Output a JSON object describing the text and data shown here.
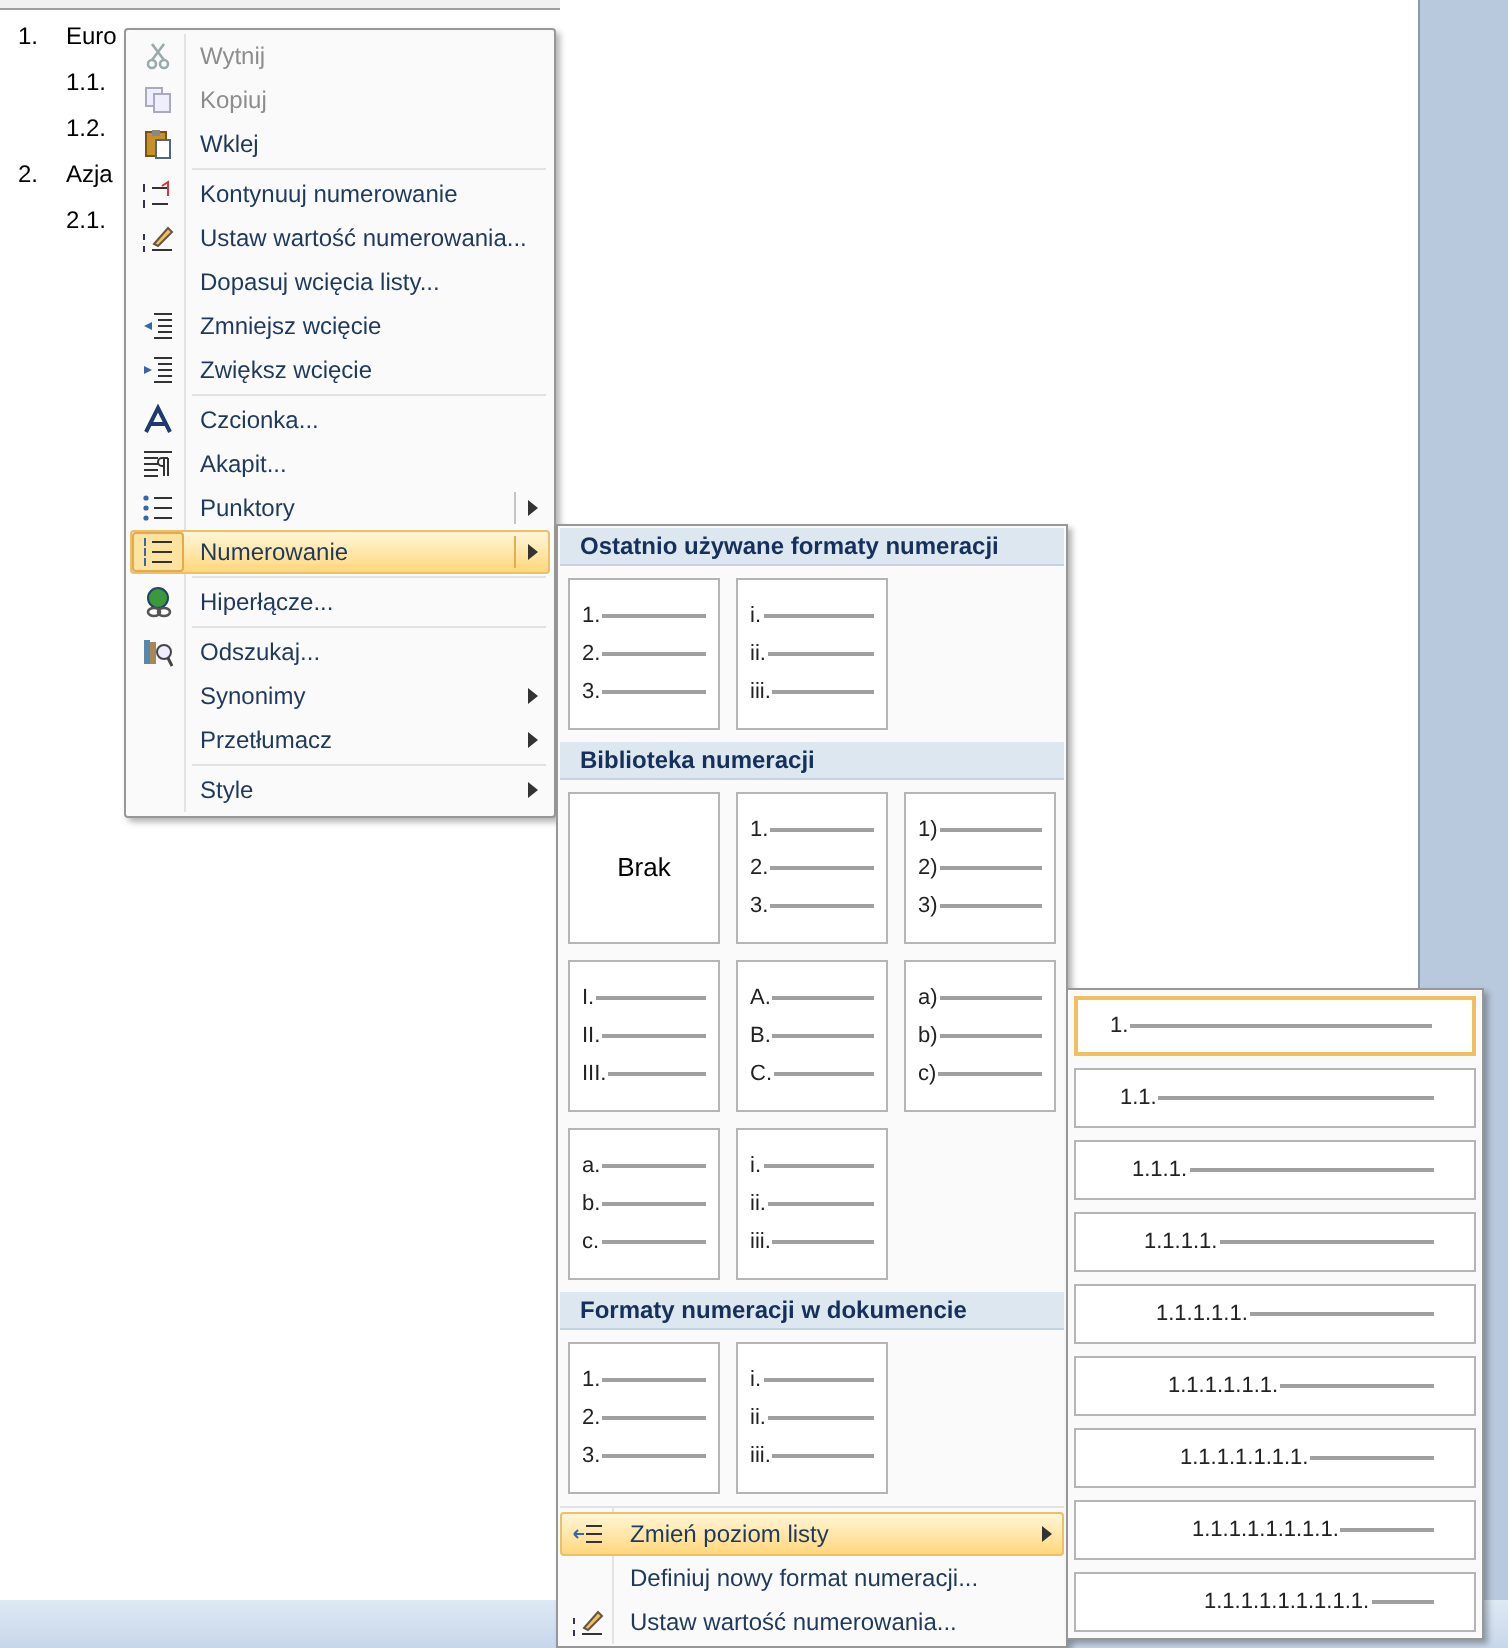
{
  "document": {
    "list": [
      {
        "number": "1.",
        "text": "Euro",
        "children": [
          {
            "number": "1.1."
          },
          {
            "number": "1.2."
          }
        ]
      },
      {
        "number": "2.",
        "text": "Azja",
        "children": [
          {
            "number": "2.1."
          }
        ]
      }
    ]
  },
  "context_menu": {
    "items": [
      {
        "kind": "item",
        "label": "Wytnij",
        "disabled": true
      },
      {
        "kind": "item",
        "label": "Kopiuj",
        "disabled": true
      },
      {
        "kind": "item",
        "label": "Wklej",
        "disabled": false
      },
      {
        "kind": "separator"
      },
      {
        "kind": "item",
        "label": "Kontynuuj numerowanie",
        "disabled": false
      },
      {
        "kind": "item",
        "label": "Ustaw wartość numerowania...",
        "disabled": false
      },
      {
        "kind": "item",
        "label": "Dopasuj wcięcia listy...",
        "disabled": false
      },
      {
        "kind": "item",
        "label": "Zmniejsz wcięcie",
        "disabled": false
      },
      {
        "kind": "item",
        "label": "Zwiększ wcięcie",
        "disabled": false
      },
      {
        "kind": "separator"
      },
      {
        "kind": "item",
        "label": "Czcionka...",
        "disabled": false
      },
      {
        "kind": "item",
        "label": "Akapit...",
        "disabled": false
      },
      {
        "kind": "split",
        "label": "Punktory",
        "selected": false
      },
      {
        "kind": "split",
        "label": "Numerowanie",
        "selected": true
      },
      {
        "kind": "separator"
      },
      {
        "kind": "item",
        "label": "Hiperłącze...",
        "disabled": false
      },
      {
        "kind": "separator"
      },
      {
        "kind": "item",
        "label": "Odszukaj...",
        "disabled": false
      },
      {
        "kind": "submenu",
        "label": "Synonimy"
      },
      {
        "kind": "submenu",
        "label": "Przetłumacz"
      },
      {
        "kind": "separator"
      },
      {
        "kind": "submenu",
        "label": "Style"
      }
    ]
  },
  "numbering_menu": {
    "sections": [
      {
        "title": "Ostatnio używane formaty numeracji",
        "tiles": [
          {
            "kind": "list",
            "markers": [
              "1.",
              "2.",
              "3."
            ]
          },
          {
            "kind": "list",
            "markers": [
              "i.",
              "ii.",
              "iii."
            ]
          }
        ]
      },
      {
        "title": "Biblioteka numeracji",
        "tiles": [
          {
            "kind": "none",
            "label": "Brak"
          },
          {
            "kind": "list",
            "markers": [
              "1.",
              "2.",
              "3."
            ]
          },
          {
            "kind": "list",
            "markers": [
              "1)",
              "2)",
              "3)"
            ]
          },
          {
            "kind": "list",
            "markers": [
              "I.",
              "II.",
              "III."
            ]
          },
          {
            "kind": "list",
            "markers": [
              "A.",
              "B.",
              "C."
            ]
          },
          {
            "kind": "list",
            "markers": [
              "a)",
              "b)",
              "c)"
            ]
          },
          {
            "kind": "list",
            "markers": [
              "a.",
              "b.",
              "c."
            ]
          },
          {
            "kind": "list",
            "markers": [
              "i.",
              "ii.",
              "iii."
            ]
          }
        ]
      },
      {
        "title": "Formaty numeracji w dokumencie",
        "tiles": [
          {
            "kind": "list",
            "markers": [
              "1.",
              "2.",
              "3."
            ]
          },
          {
            "kind": "list",
            "markers": [
              "i.",
              "ii.",
              "iii."
            ]
          }
        ]
      }
    ],
    "actions": [
      {
        "label": "Zmień poziom listy",
        "submenu": true,
        "selected": true
      },
      {
        "label": "Definiuj nowy format numeracji...",
        "submenu": false,
        "selected": false
      },
      {
        "label": "Ustaw wartość numerowania...",
        "submenu": false,
        "selected": false
      }
    ]
  },
  "list_level_menu": {
    "levels": [
      {
        "label": "1.",
        "selected": true
      },
      {
        "label": "1.1.",
        "selected": false
      },
      {
        "label": "1.1.1.",
        "selected": false
      },
      {
        "label": "1.1.1.1.",
        "selected": false
      },
      {
        "label": "1.1.1.1.1.",
        "selected": false
      },
      {
        "label": "1.1.1.1.1.1.",
        "selected": false
      },
      {
        "label": "1.1.1.1.1.1.1.",
        "selected": false
      },
      {
        "label": "1.1.1.1.1.1.1.1.",
        "selected": false
      },
      {
        "label": "1.1.1.1.1.1.1.1.1.",
        "selected": false
      }
    ]
  }
}
